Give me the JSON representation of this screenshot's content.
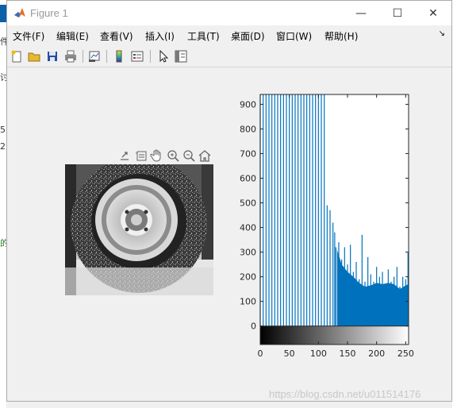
{
  "window": {
    "title": "Figure 1",
    "controls": {
      "minimize": "—",
      "maximize": "☐",
      "close": "✕"
    }
  },
  "background_text": [
    "件",
    "讨",
    "5",
    "2",
    "的"
  ],
  "menu": {
    "items": [
      "文件(F)",
      "编辑(E)",
      "查看(V)",
      "插入(I)",
      "工具(T)",
      "桌面(D)",
      "窗口(W)",
      "帮助(H)"
    ],
    "overflow_icon": "↘"
  },
  "toolbar": {
    "icons": [
      "new-figure-icon",
      "open-file-icon",
      "save-icon",
      "print-icon",
      "link-plot-icon",
      "colorbar-icon",
      "legend-icon",
      "pointer-icon",
      "property-editor-icon"
    ]
  },
  "axes_toolbar": {
    "icons": [
      "export-icon",
      "brush-icon",
      "pan-icon",
      "zoom-in-icon",
      "zoom-out-icon",
      "home-icon"
    ]
  },
  "chart_data": {
    "type": "bar",
    "title": "",
    "xlabel": "",
    "ylabel": "",
    "xlim": [
      0,
      255
    ],
    "ylim": [
      -75,
      940
    ],
    "xticks": [
      0,
      50,
      100,
      150,
      200,
      250
    ],
    "yticks": [
      0,
      100,
      200,
      300,
      400,
      500,
      600,
      700,
      800,
      900
    ],
    "bar_color": "#0072bd",
    "clipped_spikes_x": [
      0,
      5,
      10,
      15,
      20,
      25,
      30,
      35,
      40,
      45,
      50,
      55,
      60,
      65,
      70,
      75,
      80,
      85,
      90,
      95,
      100,
      105,
      110
    ],
    "tail_lines": [
      {
        "x": 115,
        "y": 490
      },
      {
        "x": 120,
        "y": 470
      },
      {
        "x": 125,
        "y": 420
      },
      {
        "x": 128,
        "y": 380
      },
      {
        "x": 130,
        "y": 320
      },
      {
        "x": 135,
        "y": 340
      },
      {
        "x": 140,
        "y": 270
      },
      {
        "x": 145,
        "y": 320
      },
      {
        "x": 150,
        "y": 250
      },
      {
        "x": 155,
        "y": 330
      },
      {
        "x": 160,
        "y": 220
      },
      {
        "x": 165,
        "y": 260
      },
      {
        "x": 170,
        "y": 190
      },
      {
        "x": 175,
        "y": 370
      },
      {
        "x": 180,
        "y": 180
      },
      {
        "x": 185,
        "y": 280
      },
      {
        "x": 190,
        "y": 210
      },
      {
        "x": 195,
        "y": 180
      },
      {
        "x": 200,
        "y": 240
      },
      {
        "x": 205,
        "y": 200
      },
      {
        "x": 210,
        "y": 220
      },
      {
        "x": 215,
        "y": 170
      },
      {
        "x": 220,
        "y": 230
      },
      {
        "x": 225,
        "y": 180
      },
      {
        "x": 230,
        "y": 200
      },
      {
        "x": 235,
        "y": 240
      },
      {
        "x": 240,
        "y": 160
      },
      {
        "x": 245,
        "y": 200
      },
      {
        "x": 250,
        "y": 190
      },
      {
        "x": 254,
        "y": 300
      }
    ],
    "dense_profile": [
      {
        "x": 132,
        "y": 310
      },
      {
        "x": 140,
        "y": 250
      },
      {
        "x": 150,
        "y": 220
      },
      {
        "x": 160,
        "y": 200
      },
      {
        "x": 170,
        "y": 175
      },
      {
        "x": 180,
        "y": 160
      },
      {
        "x": 190,
        "y": 165
      },
      {
        "x": 200,
        "y": 175
      },
      {
        "x": 210,
        "y": 170
      },
      {
        "x": 220,
        "y": 175
      },
      {
        "x": 230,
        "y": 170
      },
      {
        "x": 240,
        "y": 150
      },
      {
        "x": 250,
        "y": 165
      },
      {
        "x": 255,
        "y": 170
      }
    ]
  },
  "watermark": "https://blog.csdn.net/u011514176"
}
